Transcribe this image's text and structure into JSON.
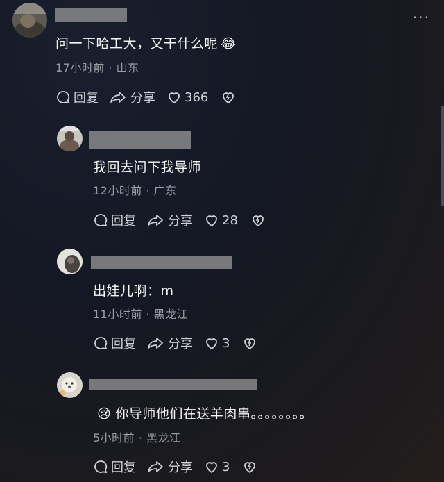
{
  "comments": [
    {
      "text": "问一下哈工大，又干什么呢",
      "emoji": "😂",
      "time": "17小时前",
      "location": "山东",
      "reply_label": "回复",
      "share_label": "分享",
      "likes": "366"
    },
    {
      "text": "我回去问下我导师",
      "time": "12小时前",
      "location": "广东",
      "reply_label": "回复",
      "share_label": "分享",
      "likes": "28"
    },
    {
      "text": "出娃儿啊：m",
      "time": "11小时前",
      "location": "黑龙江",
      "reply_label": "回复",
      "share_label": "分享",
      "likes": "3"
    },
    {
      "emoji": "😢",
      "text": "你导师他们在送羊肉串。。。。。。。。",
      "time": "5小时前",
      "location": "黑龙江",
      "reply_label": "回复",
      "share_label": "分享",
      "likes": "3"
    }
  ],
  "separator": "·",
  "icons": {
    "reply": "comment-bubble-icon",
    "share": "share-arrow-icon",
    "like": "heart-icon",
    "dislike": "broken-heart-icon",
    "more": "more-dots-icon"
  },
  "colors": {
    "text": "#f5f5f5",
    "meta": "#9a9ca4",
    "action": "#cfd1d6",
    "redaction": "#8a8a8c"
  }
}
